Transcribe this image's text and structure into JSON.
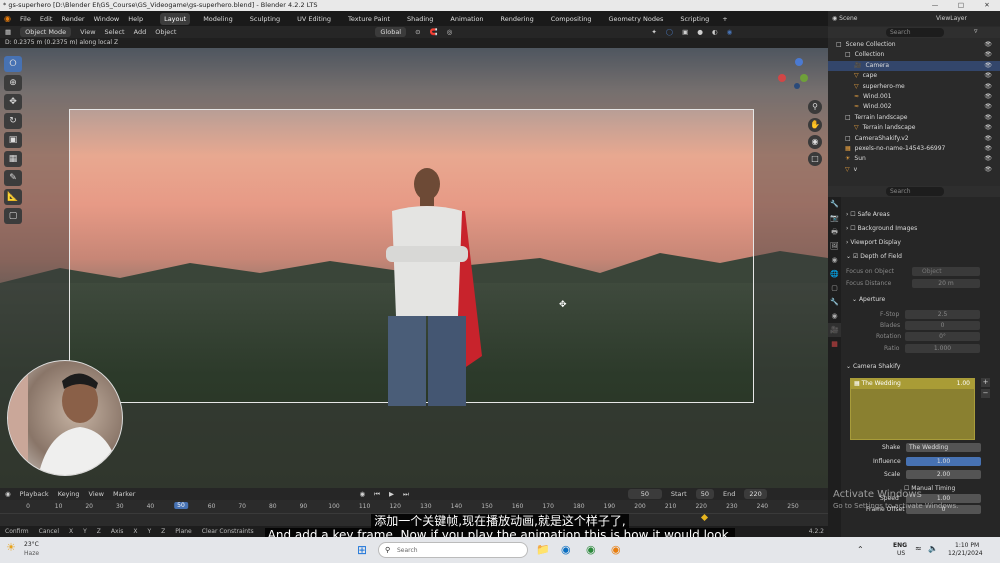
{
  "titlebar": {
    "title": "* gs-superhero [D:\\Blender EI\\GS_Course\\GS_Videogame\\gs-superhero.blend] - Blender 4.2.2 LTS"
  },
  "menu": {
    "items": [
      "File",
      "Edit",
      "Render",
      "Window",
      "Help"
    ],
    "workspaces": [
      "Layout",
      "Modeling",
      "Sculpting",
      "UV Editing",
      "Texture Paint",
      "Shading",
      "Animation",
      "Rendering",
      "Compositing",
      "Geometry Nodes",
      "Scripting"
    ],
    "add_tab": "+",
    "scene_label": "Scene",
    "viewlayer_label": "ViewLayer"
  },
  "viewport_header": {
    "mode": "Object Mode",
    "menus": [
      "View",
      "Select",
      "Add",
      "Object"
    ],
    "transform": "Global"
  },
  "viewport_status": "D: 0.2375 m (0.2375 m) along local Z",
  "timeline_header": {
    "items": [
      "Playback",
      "Keying",
      "View",
      "Marker"
    ],
    "current_frame": "50",
    "start_label": "Start",
    "start": "50",
    "end_label": "End",
    "end": "220"
  },
  "timeline": {
    "ticks": [
      "0",
      "10",
      "20",
      "30",
      "40",
      "50",
      "60",
      "70",
      "80",
      "90",
      "100",
      "110",
      "120",
      "130",
      "140",
      "150",
      "160",
      "170",
      "180",
      "190",
      "200",
      "210",
      "220",
      "230",
      "240",
      "250"
    ],
    "playhead": "50"
  },
  "statusbar": {
    "items": [
      "Confirm",
      "Cancel",
      "X",
      "Y",
      "Z",
      "Axis",
      "X",
      "Y",
      "Z",
      "Plane",
      "Clear Constraints",
      "Snap Invert",
      "Snap Toggle",
      "Move",
      "Rotate",
      "Resize"
    ],
    "version": "4.2.2"
  },
  "outliner": {
    "search_placeholder": "Search",
    "rows": [
      {
        "label": "Scene Collection",
        "indent": 0,
        "icon": "collection-icon"
      },
      {
        "label": "Collection",
        "indent": 1,
        "icon": "collection-icon"
      },
      {
        "label": "Camera",
        "indent": 2,
        "icon": "camera-icon",
        "selected": true
      },
      {
        "label": "cape",
        "indent": 2,
        "icon": "mesh-icon"
      },
      {
        "label": "superhero-me",
        "indent": 2,
        "icon": "mesh-icon"
      },
      {
        "label": "Wind.001",
        "indent": 2,
        "icon": "force-icon"
      },
      {
        "label": "Wind.002",
        "indent": 2,
        "icon": "force-icon"
      },
      {
        "label": "Terrain landscape",
        "indent": 1,
        "icon": "collection-icon"
      },
      {
        "label": "Terrain landscape",
        "indent": 2,
        "icon": "mesh-icon"
      },
      {
        "label": "CameraShakify.v2",
        "indent": 1,
        "icon": "collection-icon"
      },
      {
        "label": "pexels-no-name-14543-66997",
        "indent": 1,
        "icon": "image-icon"
      },
      {
        "label": "Sun",
        "indent": 1,
        "icon": "light-icon"
      },
      {
        "label": "v",
        "indent": 1,
        "icon": "mesh-icon"
      }
    ]
  },
  "properties": {
    "search_placeholder": "Search",
    "panels": [
      "Safe Areas",
      "Background Images",
      "Viewport Display",
      "Depth of Field"
    ],
    "dof": {
      "focus_object_label": "Focus on Object",
      "focus_object_value": "Object",
      "focus_distance_label": "Focus Distance",
      "focus_distance_value": "20 m",
      "aperture_label": "Aperture",
      "fstop_label": "F-Stop",
      "fstop": "2.5",
      "blades_label": "Blades",
      "blades": "0",
      "rotation_label": "Rotation",
      "rotation": "0°",
      "ratio_label": "Ratio",
      "ratio": "1.000"
    },
    "shakify": {
      "panel": "Camera Shakify",
      "list_item": "The Wedding",
      "list_value": "1.00",
      "shake_label": "Shake",
      "shake_value": "The Wedding",
      "influence_label": "Influence",
      "influence": "1.00",
      "scale_label": "Scale",
      "scale": "2.00",
      "manual_timing_label": "Manual Timing",
      "speed_label": "Speed",
      "speed": "1.00",
      "frame_offset_label": "Frame Offset",
      "frame_offset": "0"
    }
  },
  "watermark": {
    "line1": "Activate Windows",
    "line2": "Go to Settings to activate Windows."
  },
  "subtitles": {
    "zh": "添加一个关键帧,现在播放动画,就是这个样子了,",
    "en": "And add a key frame, Now if you play the animation this is how it would look,"
  },
  "taskbar": {
    "weather_temp": "23°C",
    "weather_desc": "Haze",
    "search_placeholder": "Search",
    "lang": "ENG",
    "region": "US",
    "time": "1:10 PM",
    "date": "12/21/2024"
  },
  "colors": {
    "accent": "#4772b3",
    "selection": "#33466b"
  }
}
